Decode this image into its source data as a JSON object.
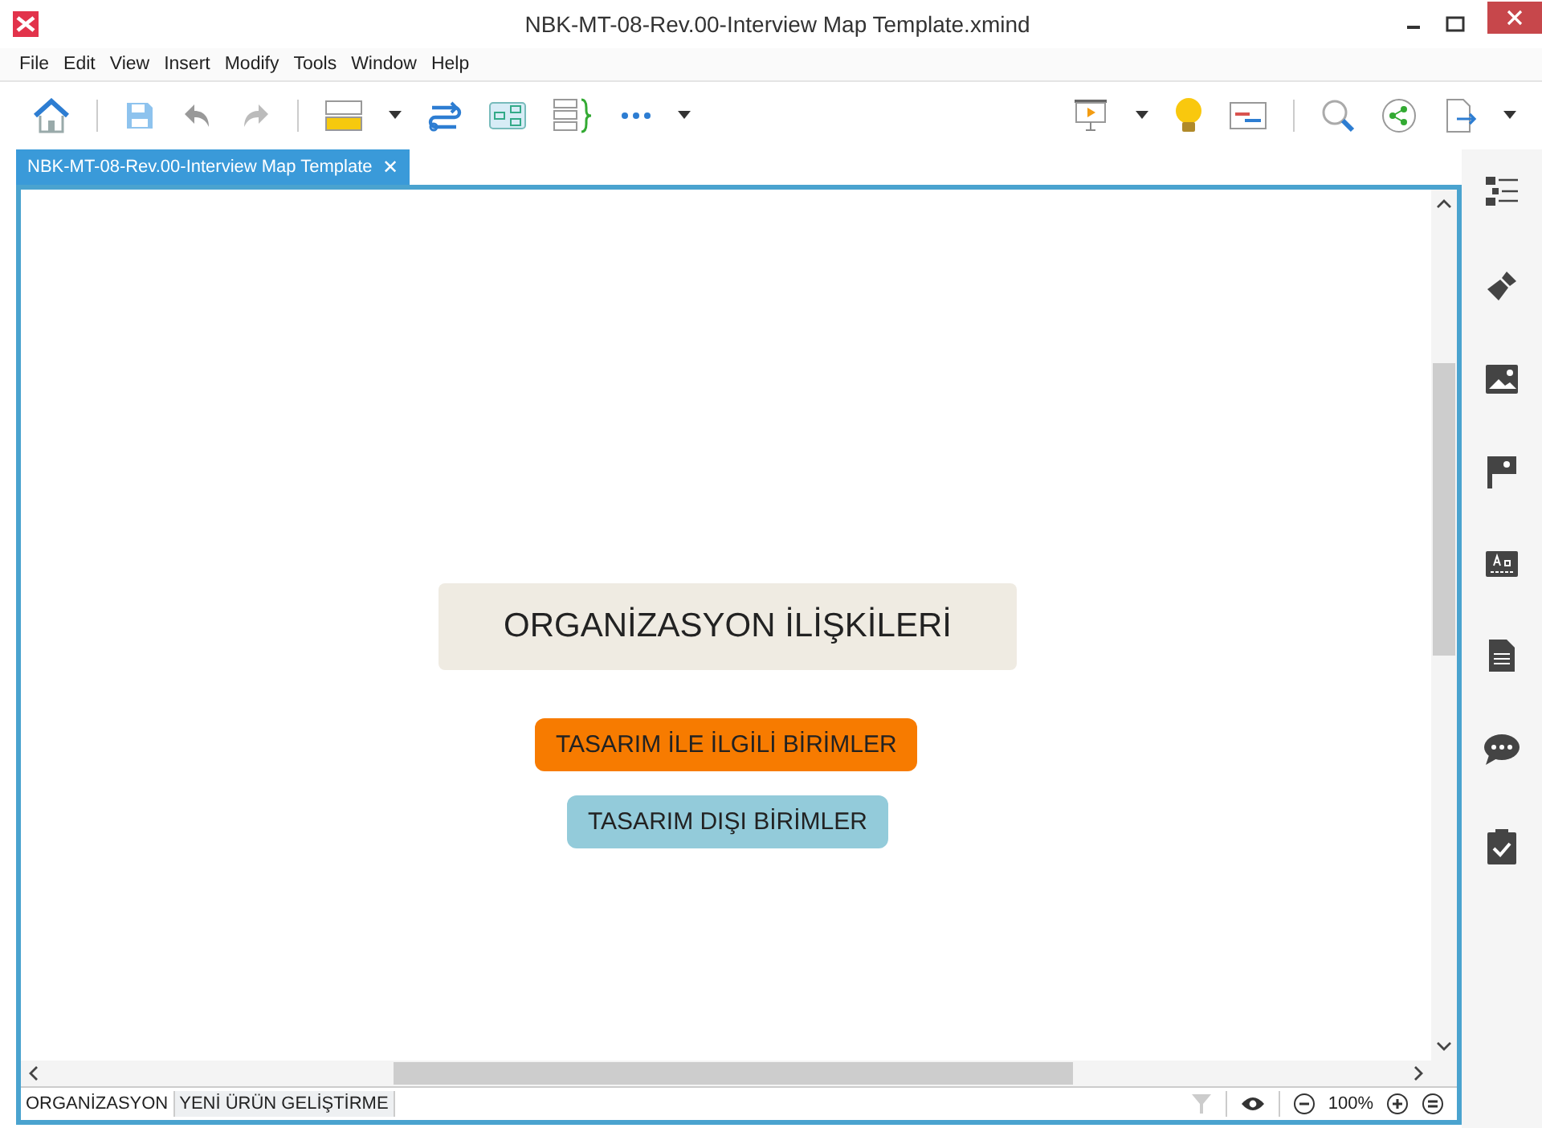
{
  "window": {
    "title": "NBK-MT-08-Rev.00-Interview Map Template.xmind"
  },
  "menu": [
    "File",
    "Edit",
    "View",
    "Insert",
    "Modify",
    "Tools",
    "Window",
    "Help"
  ],
  "editor_tab": {
    "label": "NBK-MT-08-Rev.00-Interview Map Template",
    "close": "✕"
  },
  "topics": [
    {
      "kind": "central",
      "text": "ORGANİZASYON İLİŞKİLERİ",
      "color": "#efebe2"
    },
    {
      "kind": "main",
      "text": "TASARIM İLE İLGİLİ BİRİMLER",
      "color": "#f77b00"
    },
    {
      "kind": "main",
      "text": "TASARIM DIŞI BİRİMLER",
      "color": "#93cbda"
    }
  ],
  "sheet_tabs": [
    {
      "label": "ORGANİZASYON",
      "selected": true
    },
    {
      "label": "YENİ ÜRÜN GELİŞTİRME",
      "selected": false
    }
  ],
  "zoom": "100%"
}
